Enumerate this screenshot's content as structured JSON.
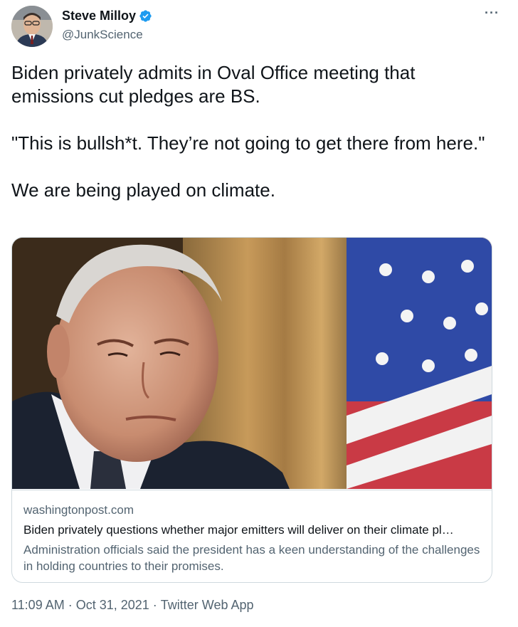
{
  "author": {
    "display_name": "Steve Milloy",
    "handle": "@JunkScience"
  },
  "more_menu": "···",
  "tweet_text": {
    "p1": "Biden privately admits in Oval Office meeting that emissions cut pledges are BS.",
    "p2": "\"This is bullsh*t. They’re not going to get there from here.\"",
    "p3": "We are being played on climate."
  },
  "link_card": {
    "domain": "washingtonpost.com",
    "title": "Biden privately questions whether major emitters will deliver on their climate pl…",
    "description": "Administration officials said the president has a keen understanding of the challenges in holding countries to their promises."
  },
  "meta": {
    "time": "11:09 AM",
    "sep1": " · ",
    "date": "Oct 31, 2021",
    "sep2": " · ",
    "source": "Twitter Web App"
  },
  "colors": {
    "verified": "#1d9bf0",
    "secondary_text": "#536471",
    "border": "#cfd9de"
  }
}
